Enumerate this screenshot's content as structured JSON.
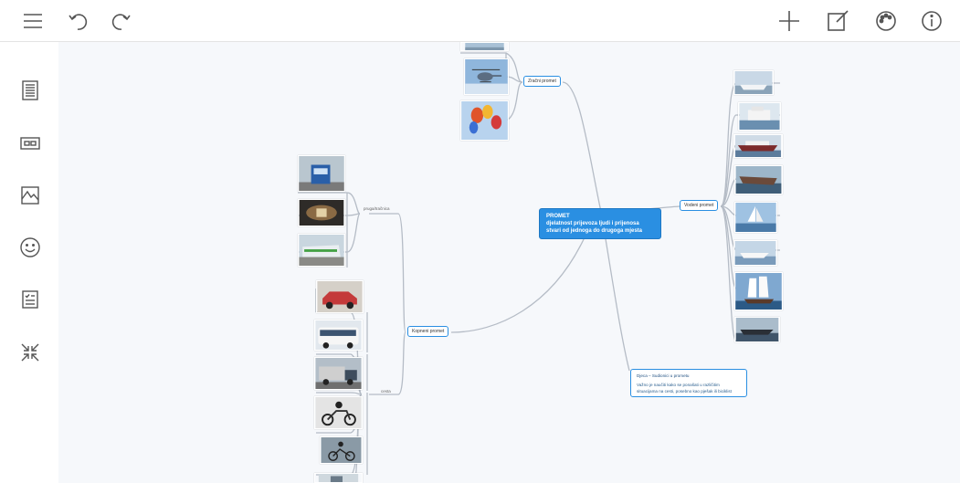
{
  "toolbar": {
    "menu_icon": "menu-icon",
    "undo_icon": "undo-icon",
    "redo_icon": "redo-icon",
    "add_icon": "plus-icon",
    "edit_icon": "edit-icon",
    "theme_icon": "palette-icon",
    "info_icon": "info-icon"
  },
  "sidebar": {
    "items": [
      "notes-icon",
      "link-icon",
      "image-icon",
      "emoji-icon",
      "task-icon",
      "collapse-icon"
    ]
  },
  "map": {
    "root": {
      "title": "PROMET",
      "subtitle": "djelatnost prijevoza ljudi i prijenosa stvari od jednoga do drugoga mjesta"
    },
    "air": {
      "label": "Zračni promet"
    },
    "water": {
      "label": "Vodeni promet"
    },
    "land": {
      "label": "Kopneni promet"
    },
    "rail": {
      "label": "pruga/tračnica"
    },
    "road": {
      "label": "cesta"
    },
    "note": {
      "title": "Djeca – Sudionici u prometu",
      "body": "Važno je naučiti kako se ponašati u različitim situacijama na cesti, posebno kao pješak ili biciklist"
    },
    "colors": {
      "accent": "#2a8fe2",
      "link": "#b5bcc6",
      "canvas": "#f6f8fb"
    }
  }
}
